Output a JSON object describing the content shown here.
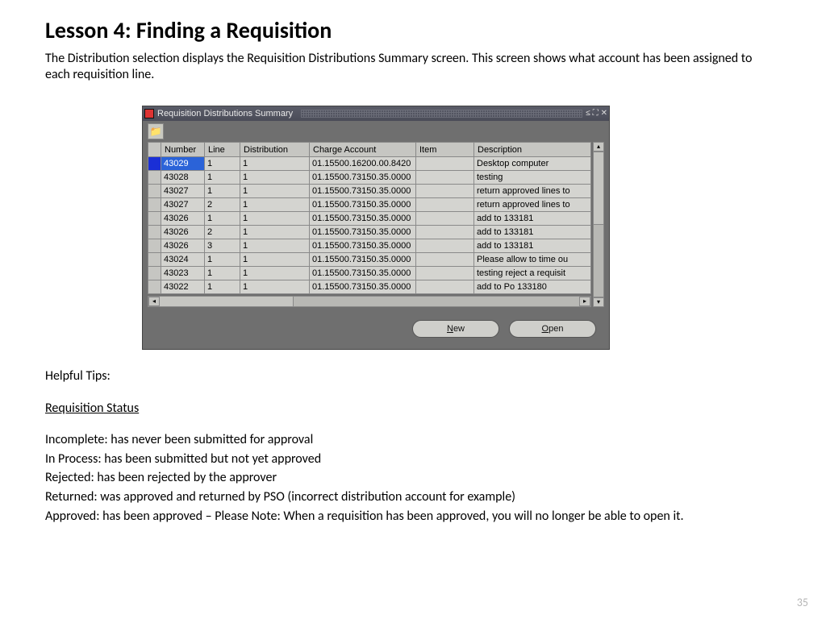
{
  "heading": "Lesson 4:  Finding a Requisition",
  "intro": "The Distribution selection displays the Requisition Distributions Summary screen.  This screen shows what account has been assigned to each requisition line.",
  "window": {
    "title": "Requisition Distributions Summary",
    "columns": [
      "Number",
      "Line",
      "Distribution",
      "Charge Account",
      "Item",
      "Description"
    ],
    "rows": [
      {
        "number": "43029",
        "line": "1",
        "dist": "1",
        "charge": "01.15500.16200.00.8420",
        "item": "",
        "desc": "Desktop computer",
        "selected": true
      },
      {
        "number": "43028",
        "line": "1",
        "dist": "1",
        "charge": "01.15500.73150.35.0000",
        "item": "",
        "desc": "testing"
      },
      {
        "number": "43027",
        "line": "1",
        "dist": "1",
        "charge": "01.15500.73150.35.0000",
        "item": "",
        "desc": "return approved lines to"
      },
      {
        "number": "43027",
        "line": "2",
        "dist": "1",
        "charge": "01.15500.73150.35.0000",
        "item": "",
        "desc": "return approved lines to"
      },
      {
        "number": "43026",
        "line": "1",
        "dist": "1",
        "charge": "01.15500.73150.35.0000",
        "item": "",
        "desc": "add to 133181"
      },
      {
        "number": "43026",
        "line": "2",
        "dist": "1",
        "charge": "01.15500.73150.35.0000",
        "item": "",
        "desc": "add to 133181"
      },
      {
        "number": "43026",
        "line": "3",
        "dist": "1",
        "charge": "01.15500.73150.35.0000",
        "item": "",
        "desc": "add to 133181"
      },
      {
        "number": "43024",
        "line": "1",
        "dist": "1",
        "charge": "01.15500.73150.35.0000",
        "item": "",
        "desc": "Please allow to time ou"
      },
      {
        "number": "43023",
        "line": "1",
        "dist": "1",
        "charge": "01.15500.73150.35.0000",
        "item": "",
        "desc": "testing reject a requisit"
      },
      {
        "number": "43022",
        "line": "1",
        "dist": "1",
        "charge": "01.15500.73150.35.0000",
        "item": "",
        "desc": "add to Po 133180"
      }
    ],
    "buttons": {
      "new": "New",
      "open": "Open"
    }
  },
  "tips": {
    "header": "Helpful Tips:",
    "status_header": "Requisition Status",
    "lines": [
      "Incomplete: has never been submitted for approval",
      "In Process: has been submitted but not yet approved",
      "Rejected: has been rejected by the approver",
      "Returned: was approved and returned by PSO  (incorrect distribution account for example)",
      "Approved: has been approved – Please Note:  When a requisition has been approved, you will no longer be able to open it."
    ]
  },
  "page_number": "35"
}
